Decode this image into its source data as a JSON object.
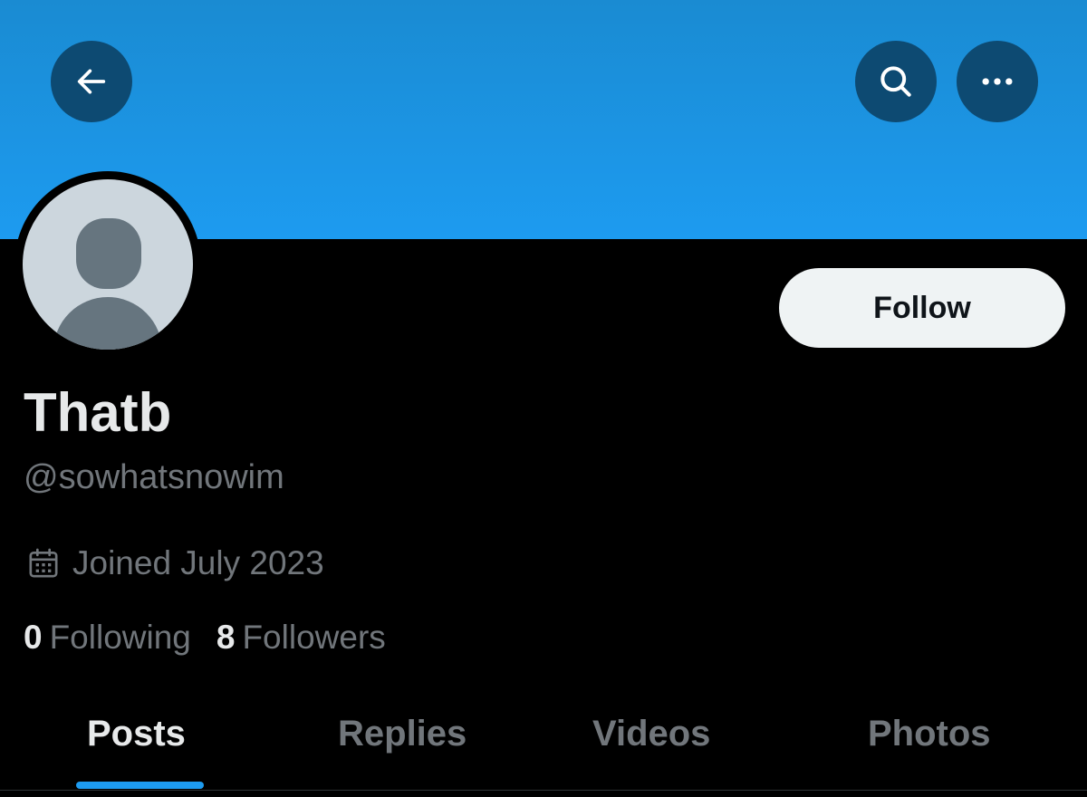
{
  "header": {
    "back_icon": "arrow-left-icon",
    "search_icon": "search-icon",
    "more_icon": "more-horizontal-icon",
    "banner_color": "#1d9bf0"
  },
  "profile": {
    "display_name": "Thatb",
    "handle": "@sowhatsnowim",
    "joined": "Joined July 2023",
    "joined_icon": "calendar-icon",
    "avatar": "default-avatar"
  },
  "actions": {
    "follow_label": "Follow"
  },
  "stats": {
    "following_count": "0",
    "following_label": "Following",
    "followers_count": "8",
    "followers_label": "Followers"
  },
  "tabs": [
    {
      "label": "Posts",
      "active": true
    },
    {
      "label": "Replies",
      "active": false
    },
    {
      "label": "Videos",
      "active": false
    },
    {
      "label": "Photos",
      "active": false
    }
  ],
  "colors": {
    "accent": "#1d9bf0",
    "background": "#000000",
    "primary_text": "#e7e9ea",
    "secondary_text": "#71767b"
  }
}
